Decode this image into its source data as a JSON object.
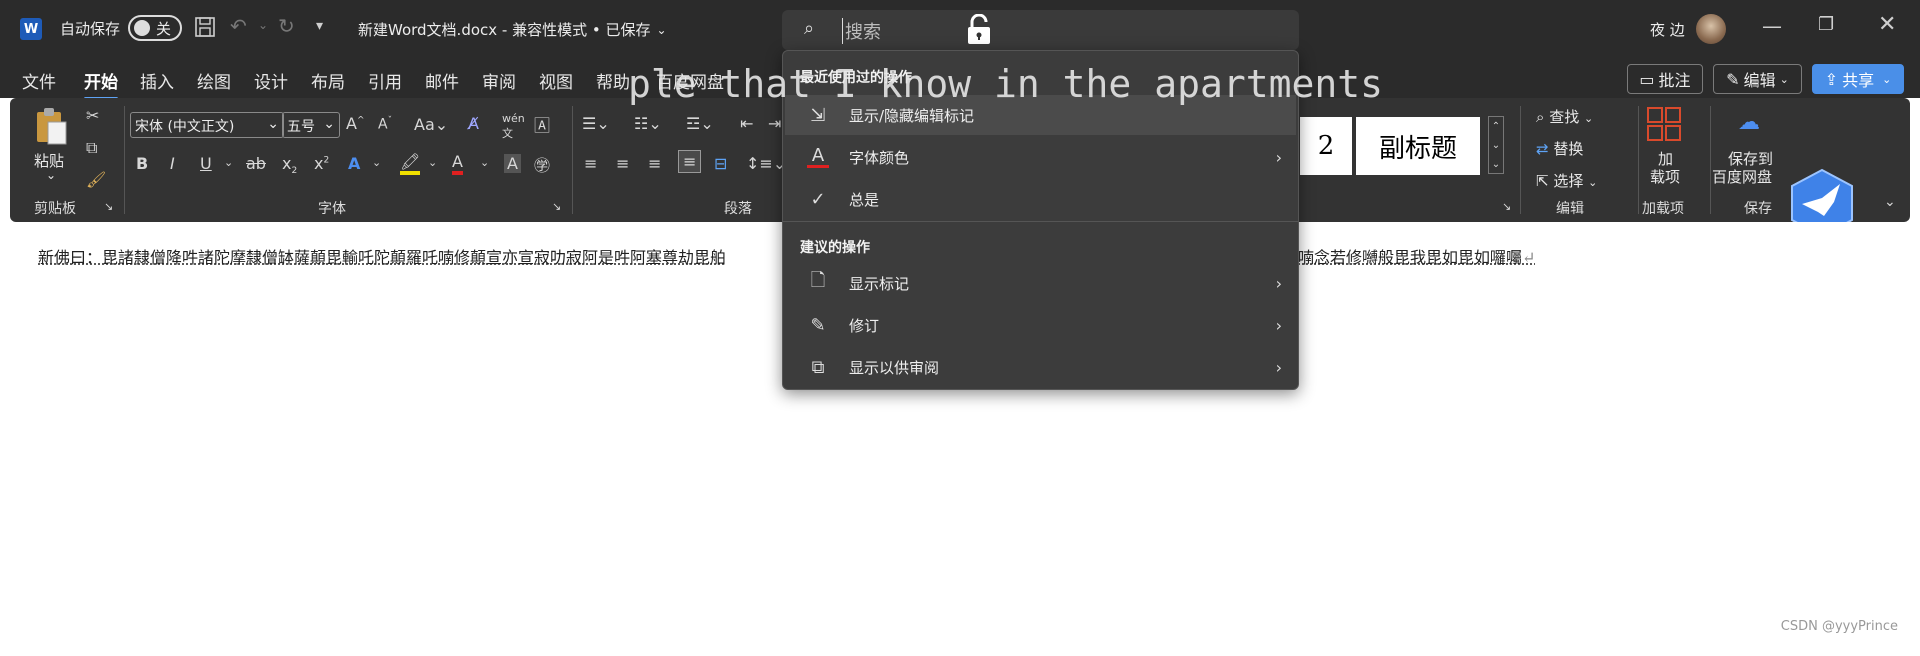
{
  "titlebar": {
    "app_icon": "W",
    "autosave_label": "自动保存",
    "autosave_state": "关",
    "doc_title": "新建Word文档.docx - 兼容性模式 • 已保存",
    "user_name": "夜 边"
  },
  "search": {
    "placeholder": "搜索"
  },
  "tabs": [
    "文件",
    "开始",
    "插入",
    "绘图",
    "设计",
    "布局",
    "引用",
    "邮件",
    "审阅",
    "视图",
    "帮助",
    "百度网盘"
  ],
  "actions": {
    "comment": "批注",
    "edit": "编辑",
    "share": "共享"
  },
  "ribbon": {
    "clipboard": {
      "paste": "粘贴",
      "label": "剪贴板"
    },
    "font": {
      "name": "宋体 (中文正文)",
      "size": "五号",
      "label": "字体"
    },
    "paragraph": {
      "label": "段落"
    },
    "styles": {
      "box1": "2",
      "box2": "副标题"
    },
    "editing": {
      "find": "查找",
      "replace": "替换",
      "select": "选择",
      "label": "编辑"
    },
    "addins": {
      "line1": "加",
      "line2": "载项",
      "label": "加载项"
    },
    "save": {
      "line1": "保存到",
      "line2": "百度网盘",
      "label": "保存"
    }
  },
  "menu": {
    "recent_header": "最近使用过的操作",
    "recent_items": [
      {
        "label": "显示/隐藏编辑标记",
        "icon": "show-hide-marks-icon"
      },
      {
        "label": "字体颜色",
        "icon": "font-color-icon"
      },
      {
        "label": "总是",
        "icon": "checkmark-icon"
      }
    ],
    "suggested_header": "建议的操作",
    "suggested_items": [
      {
        "label": "显示标记",
        "icon": "document-icon"
      },
      {
        "label": "修订",
        "icon": "track-changes-icon"
      },
      {
        "label": "显示以供审阅",
        "icon": "review-display-icon"
      }
    ]
  },
  "overlay_text": "ple that I know in the apartments",
  "document": {
    "text_left": "新佛曰：毘諸隸僧降吽諸陀摩隸僧缽薩顛毘輸吒陀顛羅吒喃修顛宣亦宣寂叻寂阿是吽阿塞尊劫毘舶",
    "text_right": "喃念若修嚩般毘我毘如毘如囉囑"
  },
  "watermark": "CSDN @yyyPrince"
}
